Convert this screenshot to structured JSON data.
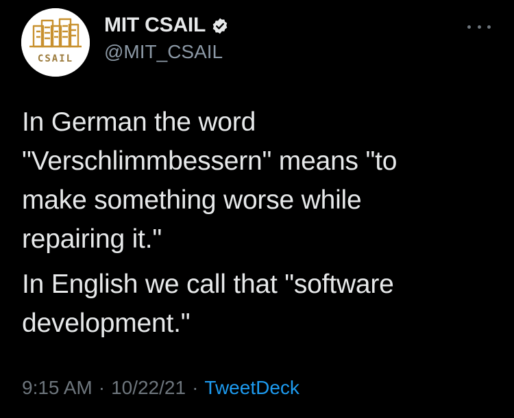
{
  "colors": {
    "background": "#000000",
    "primary_text": "#e7e9ea",
    "secondary_text": "#8b98a5",
    "accent": "#1d9bf0",
    "logo_orange": "#c8912f"
  },
  "author": {
    "display_name": "MIT CSAIL",
    "handle": "@MIT_CSAIL",
    "verified_icon": "verified-badge-icon",
    "avatar_icon": "csail-logo-icon",
    "avatar_text": "CSAIL"
  },
  "more_icon": "more-horizontal-icon",
  "tweet": {
    "paragraphs": [
      {
        "lines": [
          "In German the word",
          "\"Verschlimmbessern\" means \"to",
          "make something worse while",
          "repairing it.\""
        ]
      },
      {
        "lines": [
          "In English we call that \"software",
          "development.\""
        ]
      }
    ]
  },
  "meta": {
    "time": "9:15 AM",
    "separator": "·",
    "date": "10/22/21",
    "source": "TweetDeck"
  }
}
